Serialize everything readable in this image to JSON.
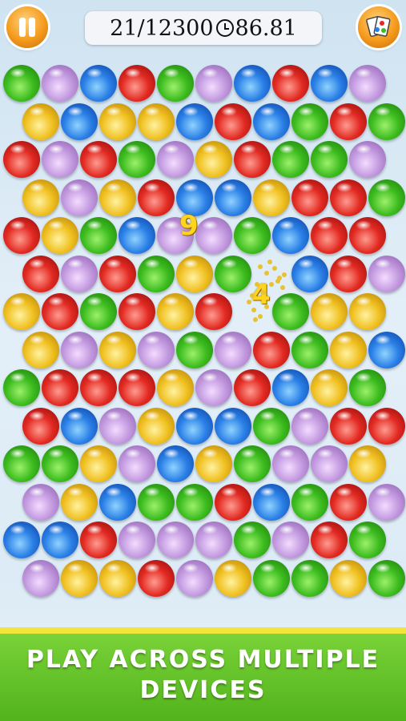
{
  "hud": {
    "progress": "21/12300",
    "time": "86.81"
  },
  "popups": [
    "9",
    "4"
  ],
  "banner": {
    "line1": "PLAY ACROSS MULTIPLE",
    "line2": "DEVICES"
  },
  "icons": {
    "pause": "pause-icon",
    "menu": "cards-menu-icon",
    "timer": "clock-icon"
  },
  "colors": {
    "green": "#3cbc1e",
    "purple": "#c39ae0",
    "blue": "#2a7fe6",
    "red": "#e22a22",
    "yellow": "#f0c020",
    "banner": "#62c128"
  },
  "grid": [
    [
      "green",
      "purple",
      "blue",
      "red",
      "green",
      "purple",
      "blue",
      "red",
      "blue",
      "purple"
    ],
    [
      "yellow",
      "blue",
      "yellow",
      "yellow",
      "blue",
      "red",
      "blue",
      "green",
      "red",
      "green"
    ],
    [
      "red",
      "purple",
      "red",
      "green",
      "purple",
      "yellow",
      "red",
      "green",
      "green",
      "purple"
    ],
    [
      "yellow",
      "purple",
      "yellow",
      "red",
      "blue",
      "blue",
      "yellow",
      "red",
      "red",
      "green"
    ],
    [
      "red",
      "yellow",
      "green",
      "blue",
      "purple",
      "purple",
      "green",
      "blue",
      "red",
      "red"
    ],
    [
      "red",
      "purple",
      "red",
      "green",
      "yellow",
      "green",
      "",
      "blue",
      "red",
      "purple"
    ],
    [
      "yellow",
      "red",
      "green",
      "red",
      "yellow",
      "red",
      "",
      "green",
      "yellow",
      "yellow"
    ],
    [
      "yellow",
      "purple",
      "yellow",
      "purple",
      "green",
      "purple",
      "red",
      "green",
      "yellow",
      "blue"
    ],
    [
      "green",
      "red",
      "red",
      "red",
      "yellow",
      "purple",
      "red",
      "blue",
      "yellow",
      "green"
    ],
    [
      "red",
      "blue",
      "purple",
      "yellow",
      "blue",
      "blue",
      "green",
      "purple",
      "red",
      "red"
    ],
    [
      "green",
      "green",
      "yellow",
      "purple",
      "blue",
      "yellow",
      "green",
      "purple",
      "purple",
      "yellow"
    ],
    [
      "purple",
      "yellow",
      "blue",
      "green",
      "green",
      "red",
      "blue",
      "green",
      "red",
      "purple"
    ],
    [
      "blue",
      "blue",
      "red",
      "purple",
      "purple",
      "purple",
      "green",
      "purple",
      "red",
      "green"
    ],
    [
      "purple",
      "yellow",
      "yellow",
      "red",
      "purple",
      "yellow",
      "green",
      "green",
      "yellow",
      "green"
    ]
  ]
}
